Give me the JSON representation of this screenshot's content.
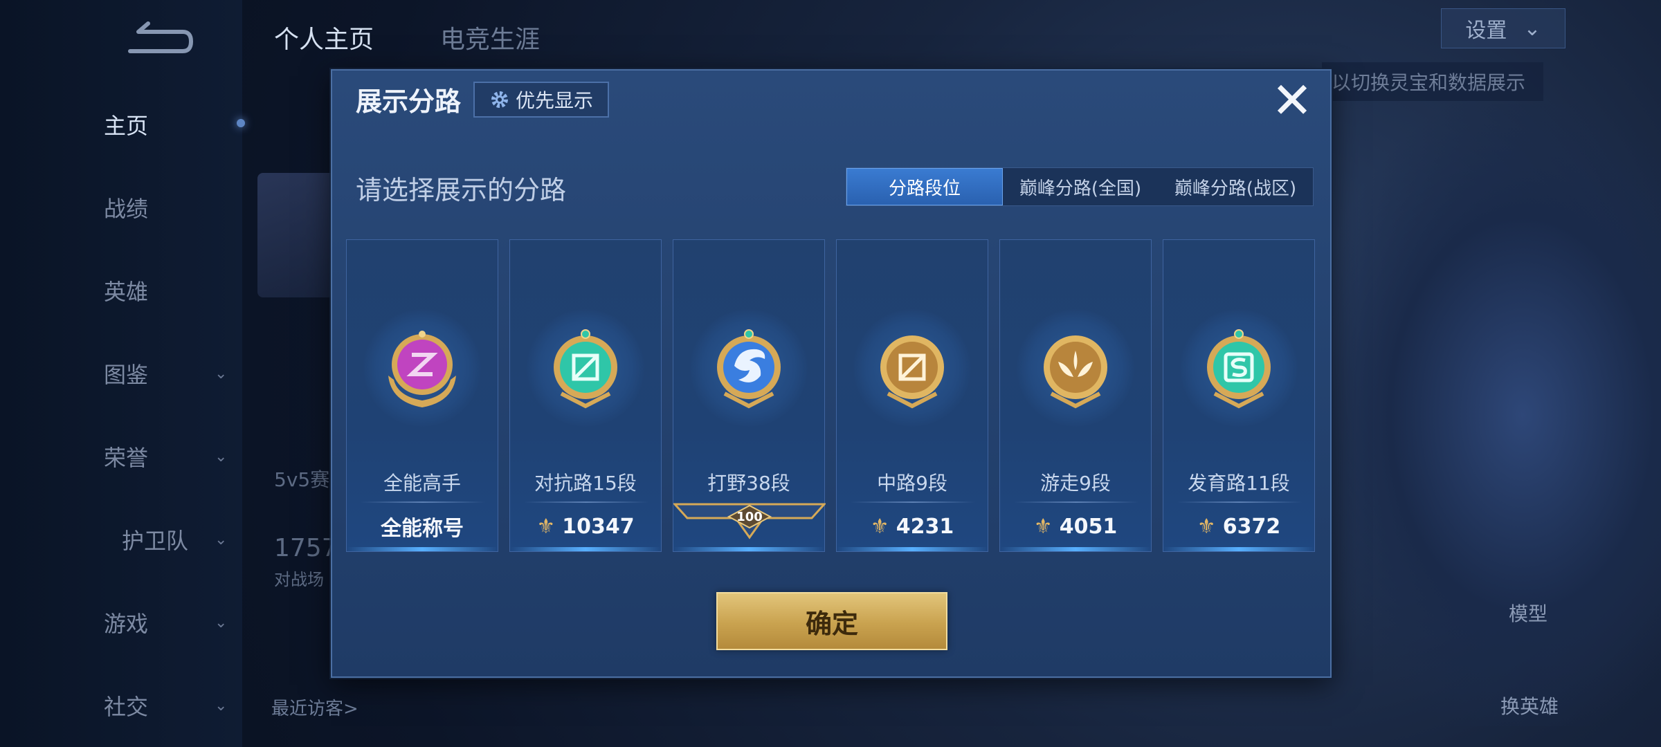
{
  "sidebar": {
    "items": [
      {
        "label": "主页",
        "chevron": false,
        "active": true
      },
      {
        "label": "战绩",
        "chevron": false
      },
      {
        "label": "英雄",
        "chevron": false
      },
      {
        "label": "图鉴",
        "chevron": true
      },
      {
        "label": "荣誉",
        "chevron": true
      },
      {
        "label": "护卫队",
        "chevron": true
      },
      {
        "label": "游戏",
        "chevron": true
      },
      {
        "label": "社交",
        "chevron": true
      }
    ]
  },
  "top_tabs": [
    {
      "label": "个人主页"
    },
    {
      "label": "电竞生涯"
    }
  ],
  "background": {
    "mode_text": "5v5赛",
    "score_text": "1757",
    "score_sub": "对战场",
    "visitors_label": "最近访客>",
    "settings_label": "设置",
    "settings_chevron": "⌄",
    "right_hint": "以切换灵宝和数据展示",
    "model_label": "模型",
    "switch_hero_label": "换英雄"
  },
  "dialog": {
    "title": "展示分路",
    "priority_label": "优先显示",
    "close_symbol": "✕",
    "subtitle": "请选择展示的分路",
    "tabs": [
      {
        "label": "分路段位",
        "active": true
      },
      {
        "label": "巅峰分路(全国)",
        "active": false
      },
      {
        "label": "巅峰分路(战区)",
        "active": false
      }
    ],
    "cards": [
      {
        "name": "全能高手",
        "value": "全能称号",
        "icon": "allround-badge-icon",
        "badge_color": "#c044c0",
        "has_coin": false
      },
      {
        "name": "对抗路15段",
        "value": "10347",
        "icon": "clash-lane-badge-icon",
        "badge_color": "#2fc6a8",
        "has_coin": true
      },
      {
        "name": "打野38段",
        "value": "100",
        "icon": "jungle-badge-icon",
        "badge_color": "#3a7ee0",
        "banner": true
      },
      {
        "name": "中路9段",
        "value": "4231",
        "icon": "mid-lane-badge-icon",
        "badge_color": "#c99a45",
        "has_coin": true
      },
      {
        "name": "游走9段",
        "value": "4051",
        "icon": "roam-badge-icon",
        "badge_color": "#c99a45",
        "has_coin": true
      },
      {
        "name": "发育路11段",
        "value": "6372",
        "icon": "farm-lane-badge-icon",
        "badge_color": "#2fc6a8",
        "has_coin": true
      }
    ],
    "confirm_label": "确定"
  }
}
